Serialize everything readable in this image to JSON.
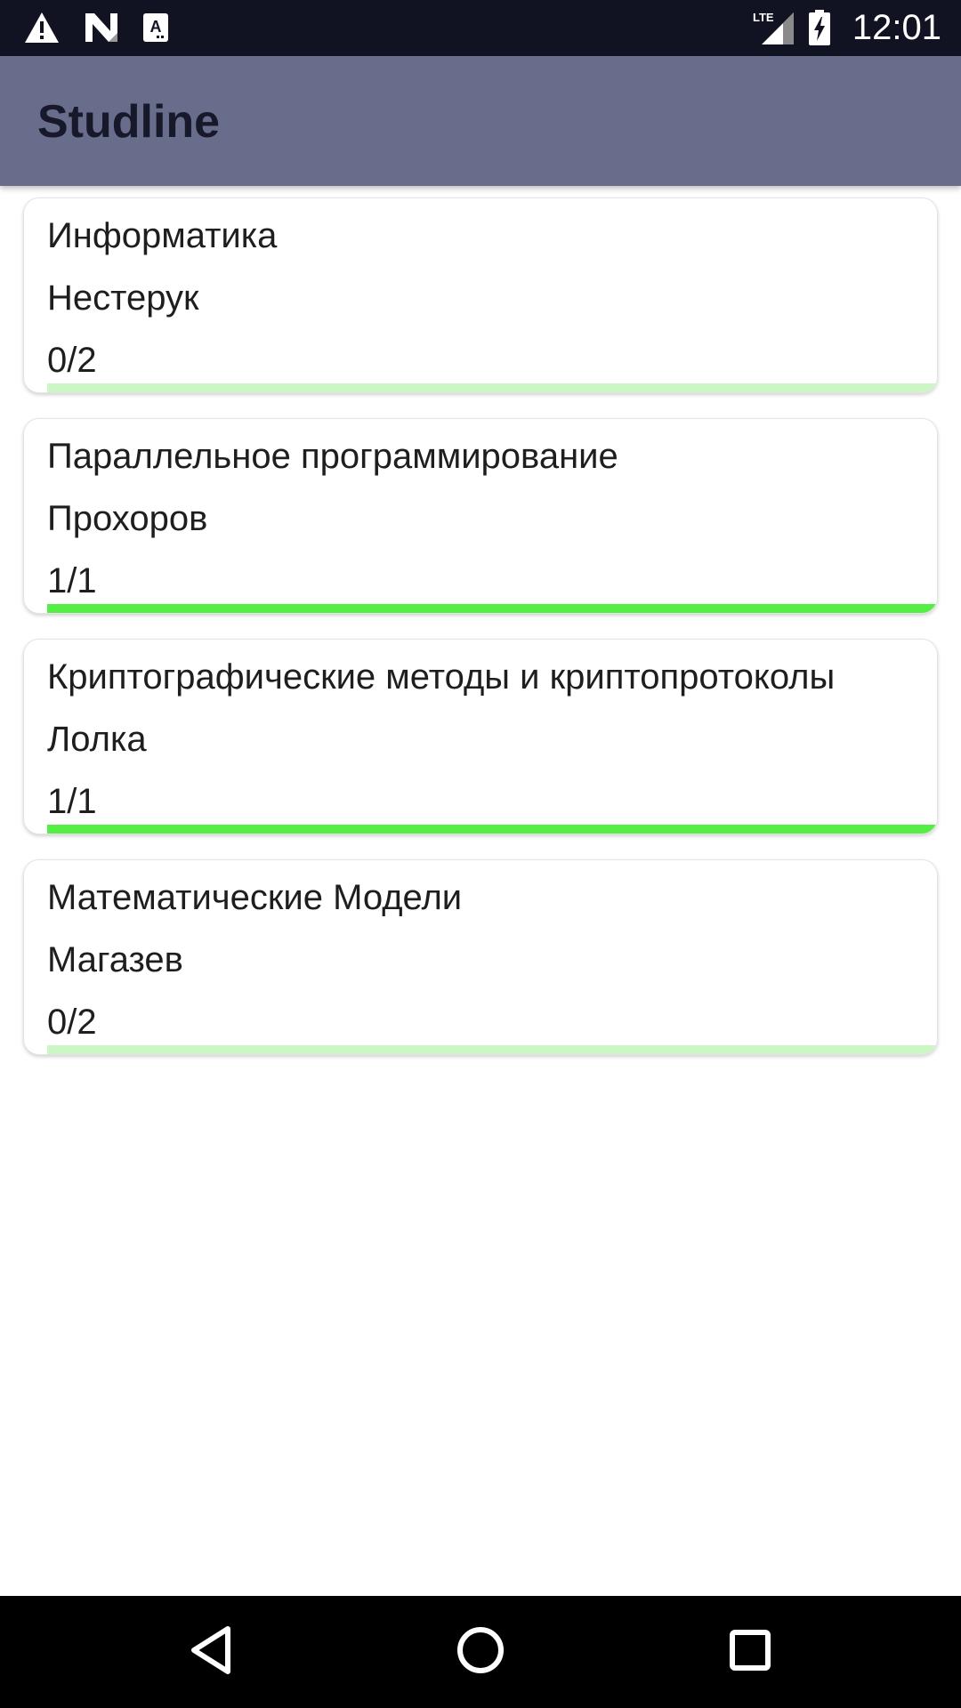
{
  "status_bar": {
    "time": "12:01",
    "left_icons": [
      "warning-icon",
      "n-icon",
      "a-notification-icon"
    ],
    "right_icons": [
      "lte-signal-icon",
      "battery-charging-icon"
    ],
    "network_label": "LTE"
  },
  "app_bar": {
    "title": "Studline",
    "color": "#686d8c"
  },
  "courses": [
    {
      "title": "Информатика",
      "teacher": "Нестерук",
      "progress_text": "0/2",
      "progress_fraction": 0.0
    },
    {
      "title": "Параллельное программирование",
      "teacher": "Прохоров",
      "progress_text": "1/1",
      "progress_fraction": 1.0
    },
    {
      "title": "Криптографические методы и криптопротоколы",
      "teacher": "Лолка",
      "progress_text": "1/1",
      "progress_fraction": 1.0
    },
    {
      "title": "Математические Модели",
      "teacher": "Магазев",
      "progress_text": "0/2",
      "progress_fraction": 0.0
    }
  ],
  "nav_bar": {
    "buttons": [
      "back-icon",
      "home-icon",
      "recents-icon"
    ]
  },
  "colors": {
    "progress_fill": "#55ee44",
    "progress_track": "#ccf7c4"
  }
}
